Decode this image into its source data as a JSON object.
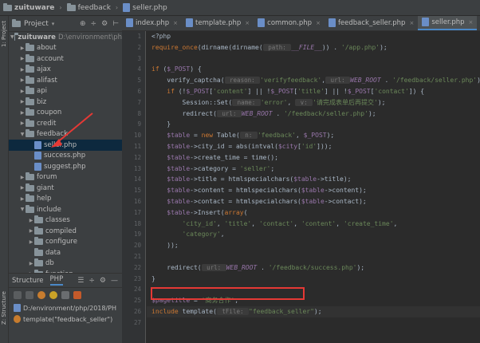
{
  "breadcrumb": [
    {
      "label": "zuituware",
      "icon": "folder-icon",
      "bold": true
    },
    {
      "label": "feedback",
      "icon": "folder-icon",
      "bold": false
    },
    {
      "label": "seller.php",
      "icon": "php-file-icon",
      "bold": false
    }
  ],
  "left_strip": {
    "project_label": "1: Project",
    "structure_label": "Z: Structure"
  },
  "project_panel": {
    "title": "Project",
    "tree": [
      {
        "label": "zuituware",
        "extra": "D:\\environment\\ph",
        "depth": 0,
        "type": "folder",
        "expanded": true
      },
      {
        "label": "about",
        "depth": 1,
        "type": "folder"
      },
      {
        "label": "account",
        "depth": 1,
        "type": "folder"
      },
      {
        "label": "ajax",
        "depth": 1,
        "type": "folder"
      },
      {
        "label": "alifast",
        "depth": 1,
        "type": "folder"
      },
      {
        "label": "api",
        "depth": 1,
        "type": "folder"
      },
      {
        "label": "biz",
        "depth": 1,
        "type": "folder"
      },
      {
        "label": "coupon",
        "depth": 1,
        "type": "folder"
      },
      {
        "label": "credit",
        "depth": 1,
        "type": "folder"
      },
      {
        "label": "feedback",
        "depth": 1,
        "type": "folder",
        "expanded": true
      },
      {
        "label": "seller.php",
        "depth": 2,
        "type": "php",
        "selected": true
      },
      {
        "label": "success.php",
        "depth": 2,
        "type": "php"
      },
      {
        "label": "suggest.php",
        "depth": 2,
        "type": "php"
      },
      {
        "label": "forum",
        "depth": 1,
        "type": "folder"
      },
      {
        "label": "giant",
        "depth": 1,
        "type": "folder"
      },
      {
        "label": "help",
        "depth": 1,
        "type": "folder"
      },
      {
        "label": "include",
        "depth": 1,
        "type": "folder",
        "expanded": true
      },
      {
        "label": "classes",
        "depth": 2,
        "type": "folder"
      },
      {
        "label": "compiled",
        "depth": 2,
        "type": "folder"
      },
      {
        "label": "configure",
        "depth": 2,
        "type": "folder"
      },
      {
        "label": "data",
        "depth": 2,
        "type": "folder",
        "leaf": true
      },
      {
        "label": "db",
        "depth": 2,
        "type": "folder"
      },
      {
        "label": "function",
        "depth": 2,
        "type": "folder"
      }
    ]
  },
  "structure_panel": {
    "tabs": [
      "Structure",
      "PHP"
    ],
    "items": [
      {
        "label": "D:/environment/php/2018/PH",
        "icon": "php-file-icon"
      },
      {
        "label": "template(\"feedback_seller\")",
        "icon": "function-icon"
      }
    ]
  },
  "editor_tabs": [
    {
      "label": "index.php",
      "active": false
    },
    {
      "label": "template.php",
      "active": false
    },
    {
      "label": "common.php",
      "active": false
    },
    {
      "label": "feedback_seller.php",
      "active": false
    },
    {
      "label": "seller.php",
      "active": true
    },
    {
      "label": "feedb",
      "active": false
    }
  ],
  "code": {
    "line_numbers": [
      "1",
      "2",
      "3",
      "4",
      "5",
      "6",
      "7",
      "8",
      "9",
      "10",
      "11",
      "12",
      "13",
      "14",
      "15",
      "16",
      "17",
      "18",
      "19",
      "20",
      "21",
      "22",
      "23",
      "24",
      "25",
      "26",
      "27"
    ],
    "lines": [
      "<?php",
      "require_once(dirname(dirname( path: __FILE__)) . '/app.php');",
      "",
      "if ($_POST) {",
      "    verify_captcha( reason: 'verifyfeedback', url: WEB_ROOT . '/feedback/seller.php');",
      "    if (!$_POST['content'] || !$_POST['title'] || !$_POST['contact']) {",
      "        Session::Set( name: 'error',  v: '请完成表单后再提交');",
      "        redirect( url: WEB_ROOT . '/feedback/seller.php');",
      "    }",
      "    $table = new Table( n: 'feedback', $_POST);",
      "    $table->city_id = abs(intval($city['id']));",
      "    $table->create_time = time();",
      "    $table->category = 'seller';",
      "    $table->title = htmlspecialchars($table->title);",
      "    $table->content = htmlspecialchars($table->content);",
      "    $table->contact = htmlspecialchars($table->contact);",
      "    $table->Insert(array(",
      "        'city_id', 'title', 'contact', 'content', 'create_time',",
      "        'category',",
      "    ));",
      "",
      "    redirect( url: WEB_ROOT . '/feedback/success.php');",
      "}",
      "",
      "$pagetitle = '商务合作';",
      "include template( tFile: \"feedback_seller\");",
      ""
    ]
  }
}
